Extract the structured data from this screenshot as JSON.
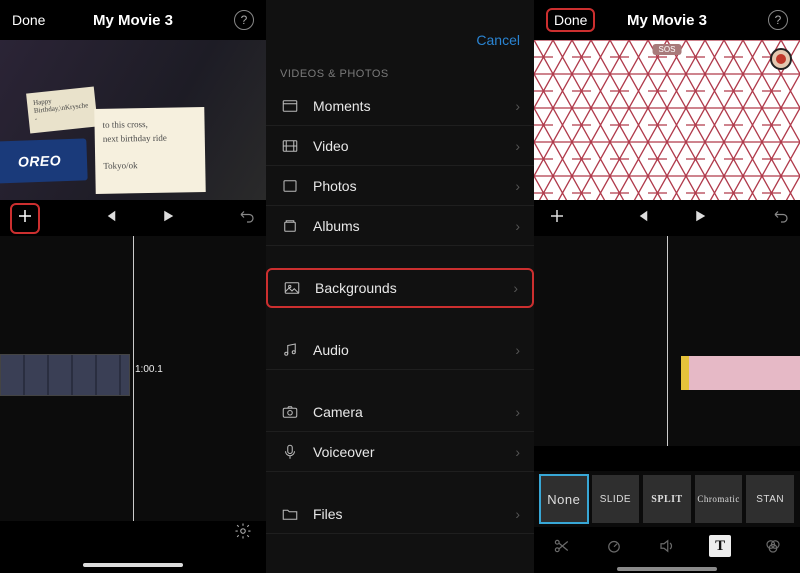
{
  "panel1": {
    "done": "Done",
    "title": "My Movie 3",
    "note_lines": [
      "to this cross,",
      "next birthday ride",
      "",
      "Tokyo/ok"
    ],
    "bday": "Happy Birthday,\\nKrysche -",
    "oreo": "OREO",
    "clip_time": "1:00.1"
  },
  "panel2": {
    "cancel": "Cancel",
    "section": "VIDEOS & PHOTOS",
    "rows": [
      {
        "icon": "moments",
        "label": "Moments"
      },
      {
        "icon": "video",
        "label": "Video"
      },
      {
        "icon": "photos",
        "label": "Photos"
      },
      {
        "icon": "albums",
        "label": "Albums"
      }
    ],
    "bg_row": {
      "icon": "image",
      "label": "Backgrounds"
    },
    "media_rows": [
      {
        "icon": "audio",
        "label": "Audio"
      }
    ],
    "capture_rows": [
      {
        "icon": "camera",
        "label": "Camera"
      },
      {
        "icon": "mic",
        "label": "Voiceover"
      }
    ],
    "files_row": {
      "icon": "folder",
      "label": "Files"
    }
  },
  "panel3": {
    "done": "Done",
    "title": "My Movie 3",
    "sos": "SOS",
    "fx": [
      "None",
      "SLIDE",
      "SPLIT",
      "Chromatic",
      "STAN"
    ]
  }
}
